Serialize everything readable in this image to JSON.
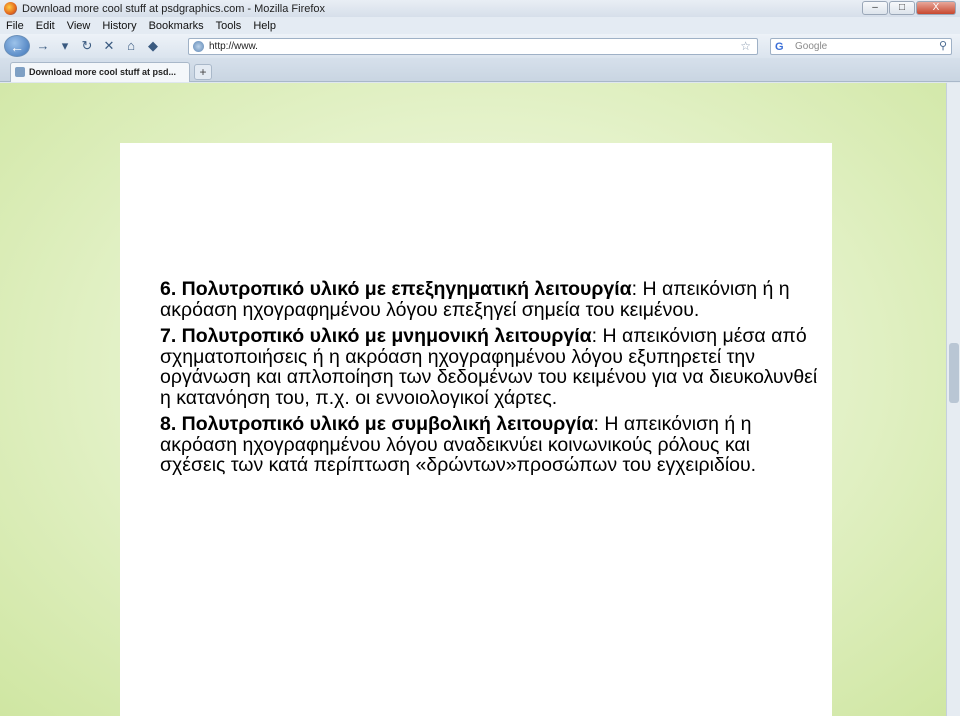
{
  "window": {
    "title": "Download more cool stuff at psdgraphics.com - Mozilla Firefox",
    "minimize": "–",
    "maximize": "□",
    "close": "X"
  },
  "menu": [
    "File",
    "Edit",
    "View",
    "History",
    "Bookmarks",
    "Tools",
    "Help"
  ],
  "nav": {
    "url": "http://www.",
    "search_placeholder": "Google"
  },
  "tab": {
    "label": "Download more cool stuff at psd...",
    "new_tab": "+"
  },
  "content": {
    "items": [
      {
        "heading": "6. Πολυτροπικό υλικό με επεξηγηματική λειτουργία",
        "body": ": Η απεικόνιση ή η ακρόαση ηχογραφημένου λόγου επεξηγεί σημεία του κειμένου."
      },
      {
        "heading": "7. Πολυτροπικό υλικό με μνημονική λειτουργία",
        "body": ": Η απεικόνιση μέσα από σχηματοποιήσεις ή η ακρόαση ηχογραφημένου λόγου εξυπηρετεί την οργάνωση και απλοποίηση των δεδομένων του κειμένου για να διευκολυνθεί η κατανόηση του, π.χ. οι εννοιολογικοί χάρτες."
      },
      {
        "heading": "8. Πολυτροπικό υλικό με συμβολική λειτουργία",
        "body": ": Η απεικόνιση ή η ακρόαση ηχογραφημένου λόγου αναδεικνύει κοινωνικούς ρόλους και σχέσεις των κατά περίπτωση «δρώντων»προσώπων του εγχειριδίου."
      }
    ]
  },
  "icons": {
    "back": "back-arrow-icon",
    "forward": "forward-arrow-icon",
    "reload": "reload-icon",
    "stop": "stop-icon",
    "home": "home-icon",
    "bookmark": "star-icon",
    "search": "magnifier-icon"
  },
  "colors": {
    "background_center": "#f7fcec",
    "background_edge": "#cfe6a2",
    "card": "#ffffff"
  }
}
